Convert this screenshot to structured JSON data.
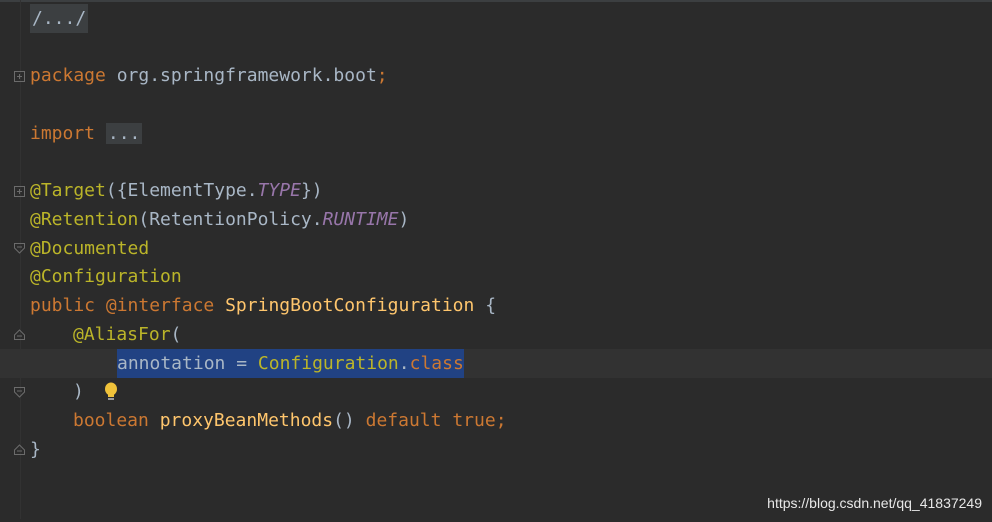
{
  "editor": {
    "lines": {
      "l1": "/.../",
      "l2_kw": "package",
      "l2_rest": " org.springframework.boot",
      "l2_semi": ";",
      "l3_kw": "import",
      "l3_fold": "...",
      "l4_ann": "@Target",
      "l4_a": "({ElementType.",
      "l4_const": "TYPE",
      "l4_b": "})",
      "l5_ann": "@Retention",
      "l5_a": "(RetentionPolicy.",
      "l5_const": "RUNTIME",
      "l5_b": ")",
      "l6_ann": "@Documented",
      "l7_ann": "@Configuration",
      "l8_kw1": "public",
      "l8_ann": "@interface",
      "l8_name": "SpringBootConfiguration",
      "l8_brace": "{",
      "l9_ann": "@AliasFor",
      "l9_paren": "(",
      "l10_sel_a": "annotation = ",
      "l10_sel_ann": "Configuration",
      "l10_sel_b": ".",
      "l10_sel_kw": "class",
      "l11": ")",
      "l12_kw": "boolean",
      "l12_fn": "proxyBeanMethods",
      "l12_paren": "()",
      "l12_kw2": "default",
      "l12_kw3": "true",
      "l12_semi": ";",
      "l13": "}"
    },
    "gutter_icons": [
      "fold-icon",
      "fold-icon",
      "fold-icon",
      "fold-icon",
      "fold-icon",
      "fold-icon",
      "lightbulb-icon"
    ]
  },
  "watermark": "https://blog.csdn.net/qq_41837249",
  "colors": {
    "background": "#2b2b2b",
    "keyword": "#cc7832",
    "annotation": "#bbb529",
    "method": "#ffc66d",
    "constant": "#9876aa",
    "selection": "#214283"
  }
}
